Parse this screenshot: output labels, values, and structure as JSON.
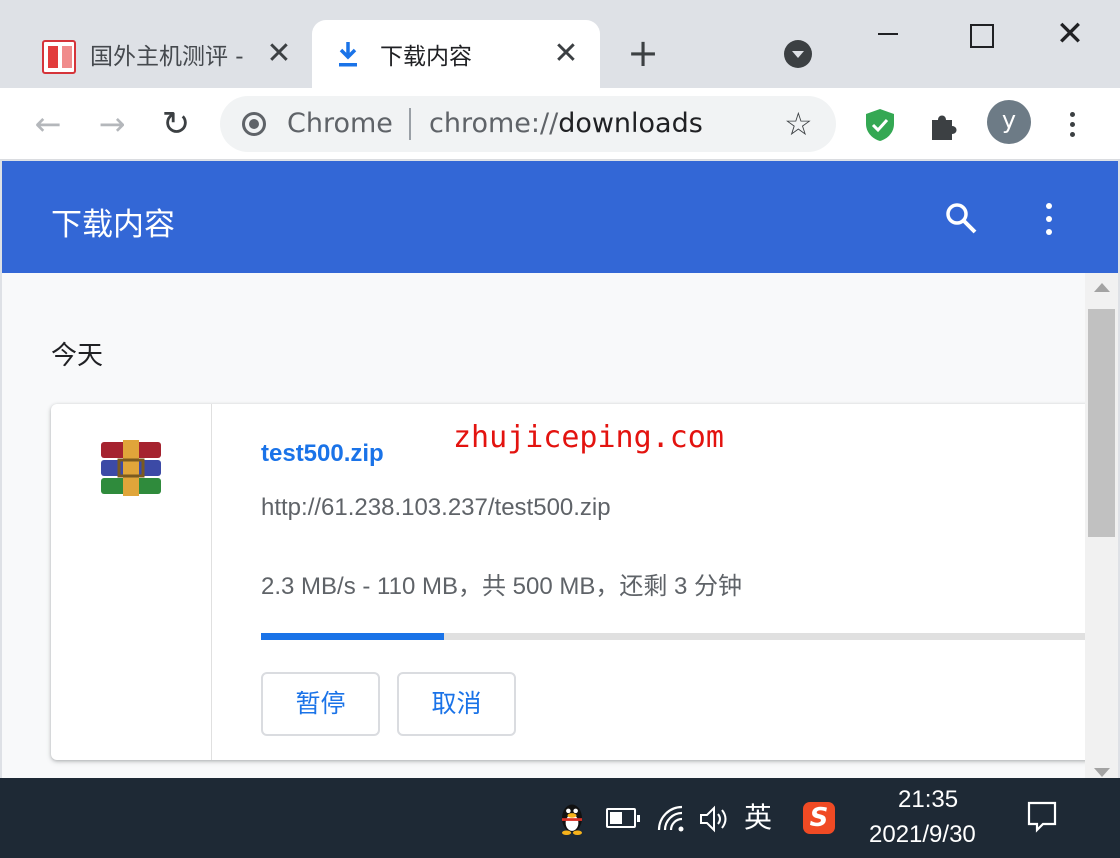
{
  "tabs": [
    {
      "title": "国外主机测评 - ",
      "active": false,
      "close_glyph": "✕"
    },
    {
      "title": "下载内容",
      "active": true,
      "close_glyph": "✕"
    }
  ],
  "toolbar": {
    "omnibox_label": "Chrome",
    "url_scheme": "chrome://",
    "url_path": "downloads",
    "avatar_letter": "y",
    "new_tab_glyph": "+"
  },
  "page": {
    "title": "下载内容",
    "section_date": "今天"
  },
  "download": {
    "file_name": "test500.zip",
    "url": "http://61.238.103.237/test500.zip",
    "status": "2.3 MB/s - 110 MB，共 500 MB，还剩 3 分钟",
    "progress": 0.22,
    "pause_label": "暂停",
    "cancel_label": "取消"
  },
  "watermark": "zhujiceping.com",
  "taskbar": {
    "ime_label": "英",
    "sogou_letter": "S",
    "time": "21:35",
    "date": "2021/9/30"
  },
  "colors": {
    "header_blue": "#3367d6",
    "link_blue": "#1a73e8",
    "watermark_red": "#e3130f",
    "taskbar": "#1e2935"
  }
}
